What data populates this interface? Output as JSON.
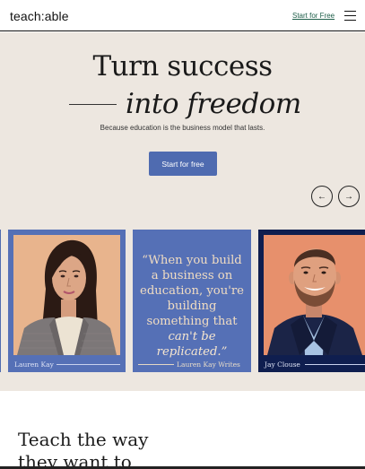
{
  "header": {
    "logo": "teach:able",
    "cta_label": "Start for Free",
    "menu_icon": "hamburger-icon"
  },
  "hero": {
    "title_line1": "Turn success",
    "title_line2": "into freedom",
    "subtitle": "Because education is the business model that lasts.",
    "cta_label": "Start for free",
    "prev_arrow": "←",
    "next_arrow": "→"
  },
  "cards": [
    {
      "type": "photo",
      "caption": "Lauren Kay"
    },
    {
      "type": "quote",
      "quote_plain": "“When you build a business on education, you're building something that",
      "quote_emphasis": "can't be replicated.”",
      "caption": "Lauren Kay Writes"
    },
    {
      "type": "photo",
      "caption": "Jay Clouse"
    }
  ],
  "lower": {
    "heading_line1": "Teach the way",
    "heading_line2": "they want to"
  },
  "colors": {
    "hero_bg": "#ede7e0",
    "accent": "#4f6bb0",
    "card_blue": "#5570b6",
    "card_navy": "#0f1e4f",
    "quote_text": "#f0dcc2",
    "link_green": "#1f5f4a"
  }
}
